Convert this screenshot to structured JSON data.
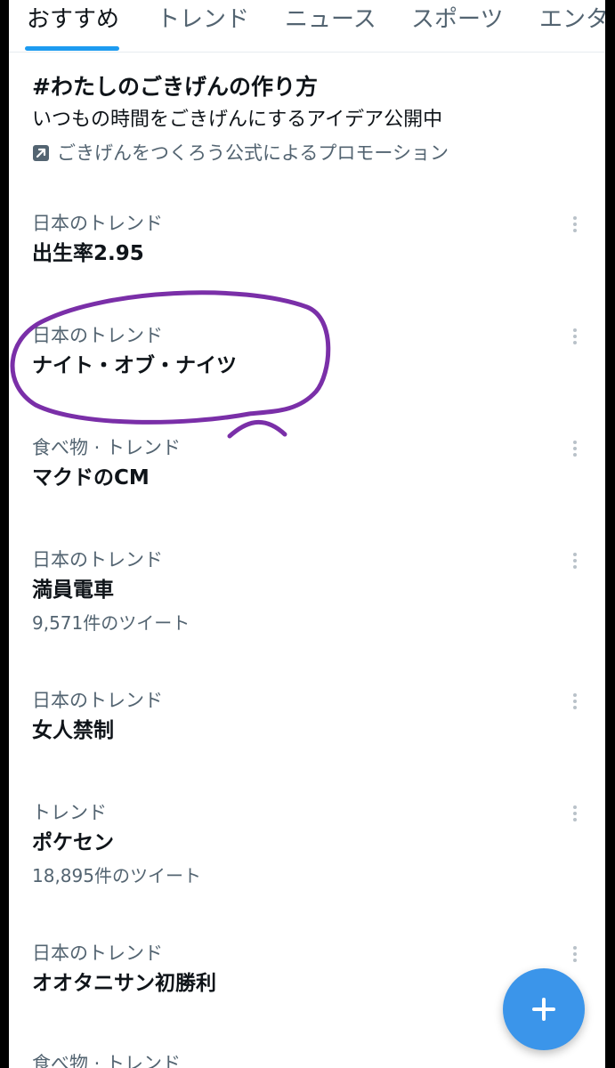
{
  "tabs": [
    {
      "label": "おすすめ",
      "active": true
    },
    {
      "label": "トレンド",
      "active": false
    },
    {
      "label": "ニュース",
      "active": false
    },
    {
      "label": "スポーツ",
      "active": false
    },
    {
      "label": "エンタ",
      "active": false
    }
  ],
  "promo": {
    "title": "#わたしのごきげんの作り方",
    "description": "いつもの時間をごきげんにするアイデア公開中",
    "sponsor": "ごきげんをつくろう公式によるプロモーション",
    "sponsor_icon": "promoted-arrow-icon"
  },
  "trends": [
    {
      "context": "日本のトレンド",
      "name": "出生率2.95",
      "count": ""
    },
    {
      "context": "日本のトレンド",
      "name": "ナイト・オブ・ナイツ",
      "count": "",
      "circled": true
    },
    {
      "context": "食べ物 · トレンド",
      "name": "マクドのCM",
      "count": ""
    },
    {
      "context": "日本のトレンド",
      "name": "満員電車",
      "count": "9,571件のツイート"
    },
    {
      "context": "日本のトレンド",
      "name": "女人禁制",
      "count": ""
    },
    {
      "context": "トレンド",
      "name": "ポケセン",
      "count": "18,895件のツイート"
    },
    {
      "context": "日本のトレンド",
      "name": "オオタニサン初勝利",
      "count": ""
    }
  ],
  "partial_item": {
    "context": "食べ物 · トレンド"
  },
  "colors": {
    "accent": "#1d9bf0",
    "fab": "#3b95ea",
    "secondary_text": "#536471",
    "annotation": "#7a2fa8"
  },
  "icons": {
    "more": "more-vertical-icon",
    "compose": "plus-icon"
  }
}
